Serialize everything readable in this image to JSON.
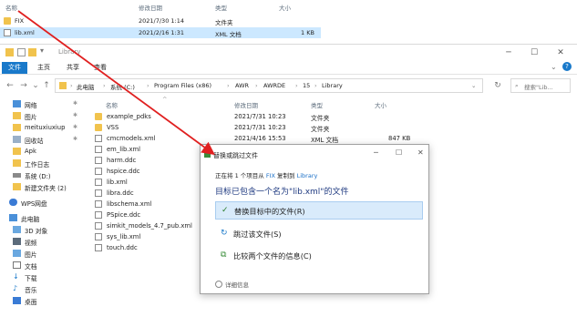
{
  "top_list": {
    "headers": {
      "name": "名称",
      "date": "修改日期",
      "type": "类型",
      "size": "大小"
    },
    "rows": [
      {
        "name": "FIX",
        "date": "2021/7/30 1:14",
        "type": "文件夹",
        "size": "",
        "selected": false
      },
      {
        "name": "lib.xml",
        "date": "2021/2/16 1:31",
        "type": "XML 文档",
        "size": "1 KB",
        "selected": true
      }
    ]
  },
  "window": {
    "title": "Library",
    "controls": {
      "minimize": "─",
      "maximize": "☐",
      "close": "✕"
    },
    "ribbon_tabs": [
      "文件",
      "主页",
      "共享",
      "查看"
    ],
    "breadcrumbs": [
      "此电脑",
      "系统 (C:)",
      "Program Files (x86)",
      "AWR",
      "AWRDE",
      "15",
      "Library"
    ],
    "search_placeholder": "搜索\"Lib..."
  },
  "sidebar": {
    "items": [
      {
        "label": "网络",
        "pinned": true,
        "icon": "network-icon"
      },
      {
        "label": "图片",
        "pinned": true,
        "icon": "folder-icon"
      },
      {
        "label": "meituxiuxiup",
        "pinned": true,
        "icon": "folder-icon"
      },
      {
        "label": "回收站",
        "pinned": true,
        "icon": "recycle-bin-icon"
      },
      {
        "label": "Apk",
        "pinned": false,
        "icon": "folder-icon"
      },
      {
        "label": "工作日志",
        "pinned": false,
        "icon": "folder-icon"
      },
      {
        "label": "系统 (D:)",
        "pinned": false,
        "icon": "drive-icon"
      },
      {
        "label": "新建文件夹 (2)",
        "pinned": false,
        "icon": "folder-icon"
      },
      {
        "label": "WPS网盘",
        "pinned": false,
        "icon": "cloud-icon"
      },
      {
        "label": "此电脑",
        "pinned": false,
        "icon": "computer-icon"
      },
      {
        "label": "3D 对象",
        "pinned": false,
        "icon": "cube-icon"
      },
      {
        "label": "视频",
        "pinned": false,
        "icon": "video-icon"
      },
      {
        "label": "图片",
        "pinned": false,
        "icon": "picture-icon"
      },
      {
        "label": "文档",
        "pinned": false,
        "icon": "document-icon"
      },
      {
        "label": "下载",
        "pinned": false,
        "icon": "download-icon"
      },
      {
        "label": "音乐",
        "pinned": false,
        "icon": "music-icon"
      },
      {
        "label": "桌面",
        "pinned": false,
        "icon": "desktop-icon"
      }
    ]
  },
  "content": {
    "headers": {
      "name": "名称",
      "date": "修改日期",
      "type": "类型",
      "size": "大小"
    },
    "files": [
      {
        "name": "example_pdks",
        "date": "2021/7/31 10:23",
        "type": "文件夹",
        "size": "",
        "kind": "folder"
      },
      {
        "name": "VSS",
        "date": "2021/7/31 10:23",
        "type": "文件夹",
        "size": "",
        "kind": "folder"
      },
      {
        "name": "cmcmodels.xml",
        "date": "2021/4/16 15:53",
        "type": "XML 文档",
        "size": "847 KB",
        "kind": "file"
      },
      {
        "name": "em_lib.xml",
        "date": "",
        "type": "",
        "size": "",
        "kind": "file"
      },
      {
        "name": "harm.ddc",
        "date": "",
        "type": "",
        "size": "",
        "kind": "file"
      },
      {
        "name": "hspice.ddc",
        "date": "",
        "type": "",
        "size": "",
        "kind": "file"
      },
      {
        "name": "lib.xml",
        "date": "",
        "type": "",
        "size": "",
        "kind": "file"
      },
      {
        "name": "libra.ddc",
        "date": "",
        "type": "",
        "size": "",
        "kind": "file"
      },
      {
        "name": "libschema.xml",
        "date": "",
        "type": "",
        "size": "",
        "kind": "file"
      },
      {
        "name": "PSpice.ddc",
        "date": "",
        "type": "",
        "size": "",
        "kind": "file"
      },
      {
        "name": "simkit_models_4.7_pub.xml",
        "date": "",
        "type": "",
        "size": "",
        "kind": "file"
      },
      {
        "name": "sys_lib.xml",
        "date": "",
        "type": "",
        "size": "",
        "kind": "file"
      },
      {
        "name": "touch.ddc",
        "date": "",
        "type": "",
        "size": "",
        "kind": "file"
      }
    ]
  },
  "dialog": {
    "title": "替换或跳过文件",
    "line1_prefix": "正在将 1 个项目从",
    "line1_source": "FIX",
    "line1_mid": "复制到",
    "line1_dest": "Library",
    "line2": "目标已包含一个名为\"lib.xml\"的文件",
    "options": [
      {
        "icon": "✓",
        "label": "替换目标中的文件(R)",
        "selected": true,
        "icon_name": "checkmark-icon"
      },
      {
        "icon": "↻",
        "label": "跳过该文件(S)",
        "selected": false,
        "icon_name": "skip-icon"
      },
      {
        "icon": "⧉",
        "label": "比较两个文件的信息(C)",
        "selected": false,
        "icon_name": "compare-icon"
      }
    ],
    "more": "详细信息",
    "controls": {
      "minimize": "─",
      "maximize": "☐",
      "close": "✕"
    }
  },
  "colors": {
    "accent": "#1979ca",
    "selection": "#cce8ff",
    "folder": "#f1c34d",
    "arrow": "#e02020"
  }
}
